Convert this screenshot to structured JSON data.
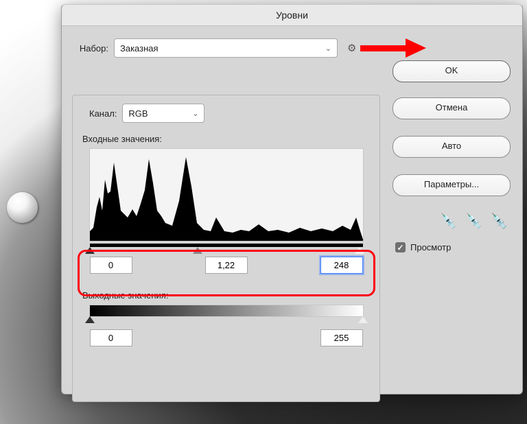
{
  "title": "Уровни",
  "preset": {
    "label": "Набор:",
    "value": "Заказная"
  },
  "channel": {
    "label": "Канал:",
    "value": "RGB"
  },
  "inputSection": {
    "label": "Входные значения:",
    "black": "0",
    "gamma": "1,22",
    "white": "248"
  },
  "outputSection": {
    "label": "Выходные значения:",
    "black": "0",
    "white": "255"
  },
  "buttons": {
    "ok": "OK",
    "cancel": "Отмена",
    "auto": "Авто",
    "options": "Параметры..."
  },
  "preview": {
    "label": "Просмотр",
    "checked": true
  }
}
